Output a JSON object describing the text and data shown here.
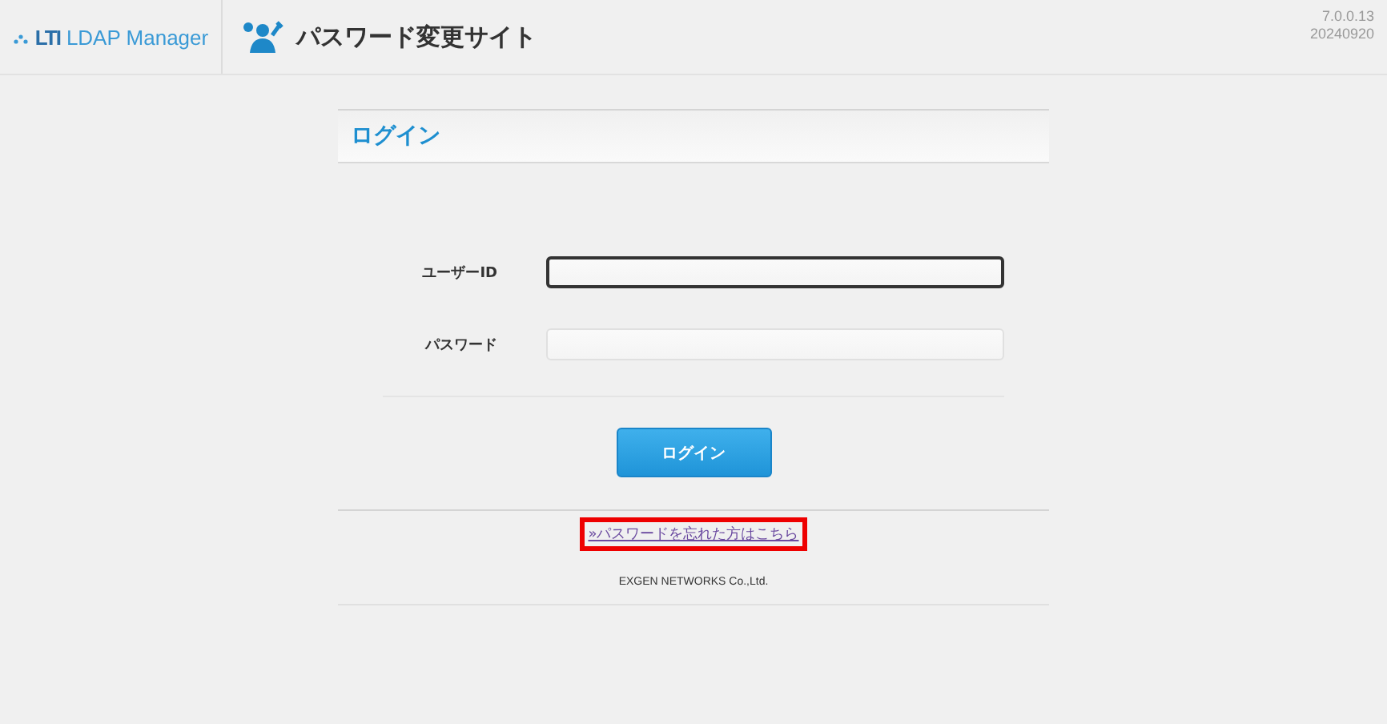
{
  "header": {
    "logo_mark": "LTI",
    "product": "LDAP Manager",
    "site_title": "パスワード変更サイト",
    "version": "7.0.0.13",
    "build": "20240920"
  },
  "panel": {
    "title": "ログイン"
  },
  "fields": [
    {
      "label": "ユーザーID",
      "focused": true
    },
    {
      "label": "パスワード",
      "focused": false
    }
  ],
  "login_button": "ログイン",
  "forgot_link": {
    "text": "»パスワードを忘れた方はこちら",
    "highlighted": true
  },
  "footer": "EXGEN NETWORKS Co.,Ltd."
}
